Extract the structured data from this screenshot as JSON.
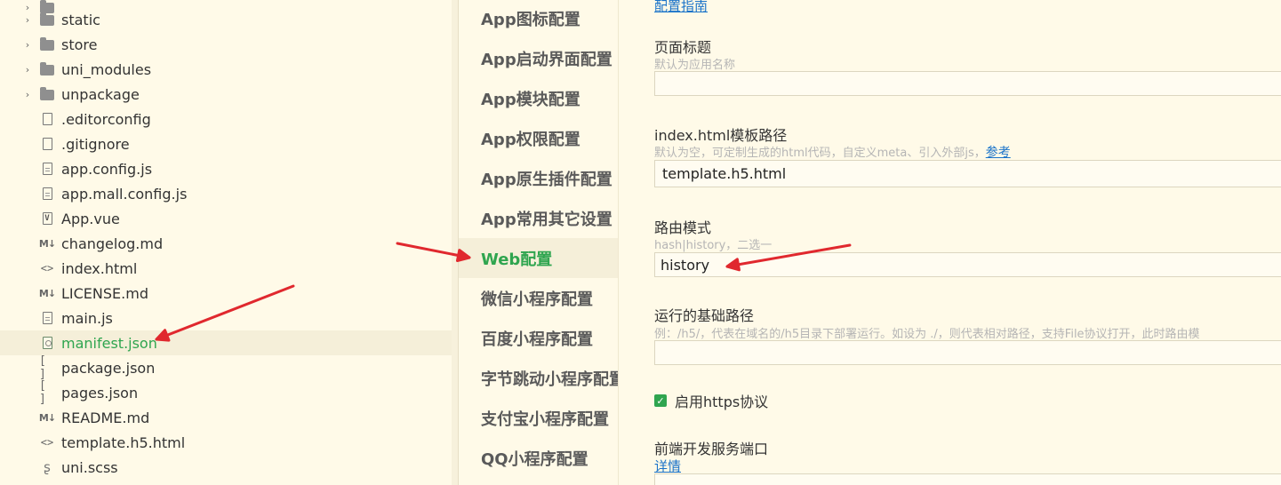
{
  "explorer": {
    "items": [
      {
        "label": "static",
        "kind": "folder"
      },
      {
        "label": "store",
        "kind": "folder"
      },
      {
        "label": "uni_modules",
        "kind": "folder"
      },
      {
        "label": "unpackage",
        "kind": "folder"
      },
      {
        "label": ".editorconfig",
        "kind": "blank"
      },
      {
        "label": ".gitignore",
        "kind": "blank"
      },
      {
        "label": "app.config.js",
        "kind": "file"
      },
      {
        "label": "app.mall.config.js",
        "kind": "file"
      },
      {
        "label": "App.vue",
        "kind": "vue"
      },
      {
        "label": "changelog.md",
        "kind": "md"
      },
      {
        "label": "index.html",
        "kind": "html"
      },
      {
        "label": "LICENSE.md",
        "kind": "md"
      },
      {
        "label": "main.js",
        "kind": "file"
      },
      {
        "label": "manifest.json",
        "kind": "gear",
        "active": true
      },
      {
        "label": "package.json",
        "kind": "json"
      },
      {
        "label": "pages.json",
        "kind": "json"
      },
      {
        "label": "README.md",
        "kind": "md"
      },
      {
        "label": "template.h5.html",
        "kind": "html"
      },
      {
        "label": "uni.scss",
        "kind": "style"
      }
    ],
    "icons": {
      "folder": "folder-icon",
      "file": "file-icon",
      "md": "markdown-icon",
      "html": "code-brackets-icon",
      "json": "json-brackets-icon",
      "vue": "vue-file-icon",
      "gear": "settings-file-icon",
      "style": "sass-icon"
    },
    "active_color": "#2fa54f"
  },
  "nav": {
    "items": [
      {
        "label": "App图标配置"
      },
      {
        "label": "App启动界面配置"
      },
      {
        "label": "App模块配置"
      },
      {
        "label": "App权限配置"
      },
      {
        "label": "App原生插件配置"
      },
      {
        "label": "App常用其它设置"
      },
      {
        "label": "Web配置",
        "active": true
      },
      {
        "label": "微信小程序配置"
      },
      {
        "label": "百度小程序配置"
      },
      {
        "label": "字节跳动小程序配置"
      },
      {
        "label": "支付宝小程序配置"
      },
      {
        "label": "QQ小程序配置"
      }
    ]
  },
  "form": {
    "top_link": "配置指南",
    "page_title": {
      "label": "页面标题",
      "hint": "默认为应用名称",
      "value": ""
    },
    "template": {
      "label": "index.html模板路径",
      "hint": "默认为空，可定制生成的html代码，自定义meta、引入外部js，",
      "hint_link": "参考",
      "value": "template.h5.html"
    },
    "router_mode": {
      "label": "路由模式",
      "hint": "hash|history，二选一",
      "value": "history"
    },
    "base_path": {
      "label": "运行的基础路径",
      "hint": "例：/h5/，代表在域名的/h5目录下部署运行。如设为 ./，则代表相对路径，支持File协议打开，此时路由模",
      "value": ""
    },
    "https": {
      "label": "启用https协议",
      "checked": true,
      "check_mark": "✓"
    },
    "dev_port": {
      "label": "前端开发服务端口",
      "link": "详情"
    }
  },
  "annotation_color": "#e0282e"
}
